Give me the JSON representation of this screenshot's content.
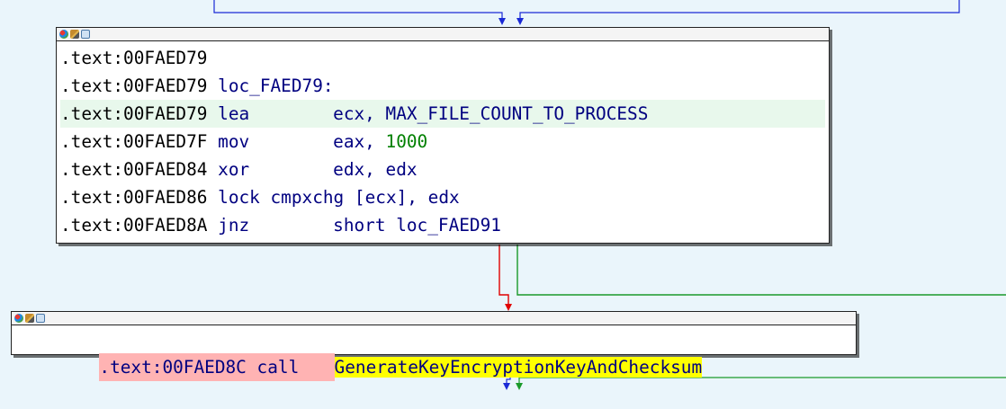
{
  "colors": {
    "background": "#eaf5fb",
    "edge_blue": "#1a2ad6",
    "edge_red": "#e00000",
    "edge_green": "#1a9a2a",
    "number_green": "#008000",
    "call_highlight": "#ffb3b3",
    "symbol_highlight": "#ffff00",
    "line_highlight": "#e8f8ec"
  },
  "nodes": {
    "top": {
      "icons": [
        "color-picker-icon",
        "edit-pencil-icon",
        "graph-overview-icon"
      ],
      "lines": [
        {
          "addr": ".text:00FAED79",
          "mnemonic": "",
          "operands": ""
        },
        {
          "addr": ".text:00FAED79",
          "label": "loc_FAED79:"
        },
        {
          "addr": ".text:00FAED79",
          "mnemonic": "lea",
          "op1": "ecx,",
          "op2": "MAX_FILE_COUNT_TO_PROCESS"
        },
        {
          "addr": ".text:00FAED7F",
          "mnemonic": "mov",
          "op1": "eax,",
          "op2": "1000"
        },
        {
          "addr": ".text:00FAED84",
          "mnemonic": "xor",
          "op1": "edx,",
          "op2": "edx"
        },
        {
          "addr": ".text:00FAED86",
          "mnemonic": "lock cmpxchg",
          "op1": "[ecx],",
          "op2": "edx"
        },
        {
          "addr": ".text:00FAED8A",
          "mnemonic": "jnz",
          "op1": "short",
          "op2": "loc_FAED91"
        }
      ]
    },
    "bottom": {
      "icons": [
        "color-picker-icon",
        "edit-pencil-icon",
        "graph-overview-icon"
      ],
      "line": {
        "addr": ".text:00FAED8C",
        "mnemonic": "call",
        "target": "GenerateKeyEncryptionKeyAndChecksum"
      }
    }
  }
}
